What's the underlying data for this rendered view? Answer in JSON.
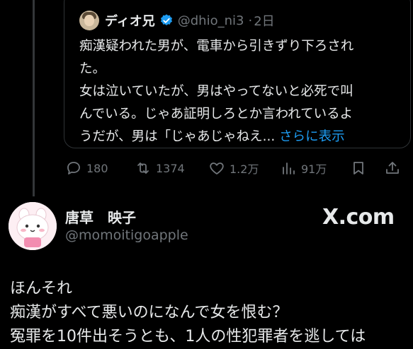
{
  "quoted_tweet": {
    "author_name": "ディオ兄",
    "handle": "@dhio_ni3",
    "separator": "·",
    "time": "2日",
    "lines": [
      "痴漢疑われた男が、電車から引きずり下ろされ",
      "た。",
      "女は泣いていたが、男はやってないと必死で叫",
      "んでいる。じゃあ証明しろとか言われているよ",
      "うだが、男は「じゃあじゃねえ..."
    ],
    "show_more": "さらに表示"
  },
  "actions": {
    "replies": "180",
    "retweets": "1374",
    "likes": "1.2万",
    "views": "91万"
  },
  "post": {
    "display_name": "唐草　映子",
    "handle": "@momoitigoapple",
    "watermark": "X.com",
    "lines": [
      "ほんそれ",
      "痴漢がすべて悪いのになんで女を恨む？",
      "冤罪を10件出そうとも、1人の性犯罪者を逃しては"
    ]
  },
  "colors": {
    "background": "#000000",
    "text": "#e7e9ea",
    "muted": "#71767b",
    "accent": "#1d9bf0",
    "border": "#2f3336"
  }
}
